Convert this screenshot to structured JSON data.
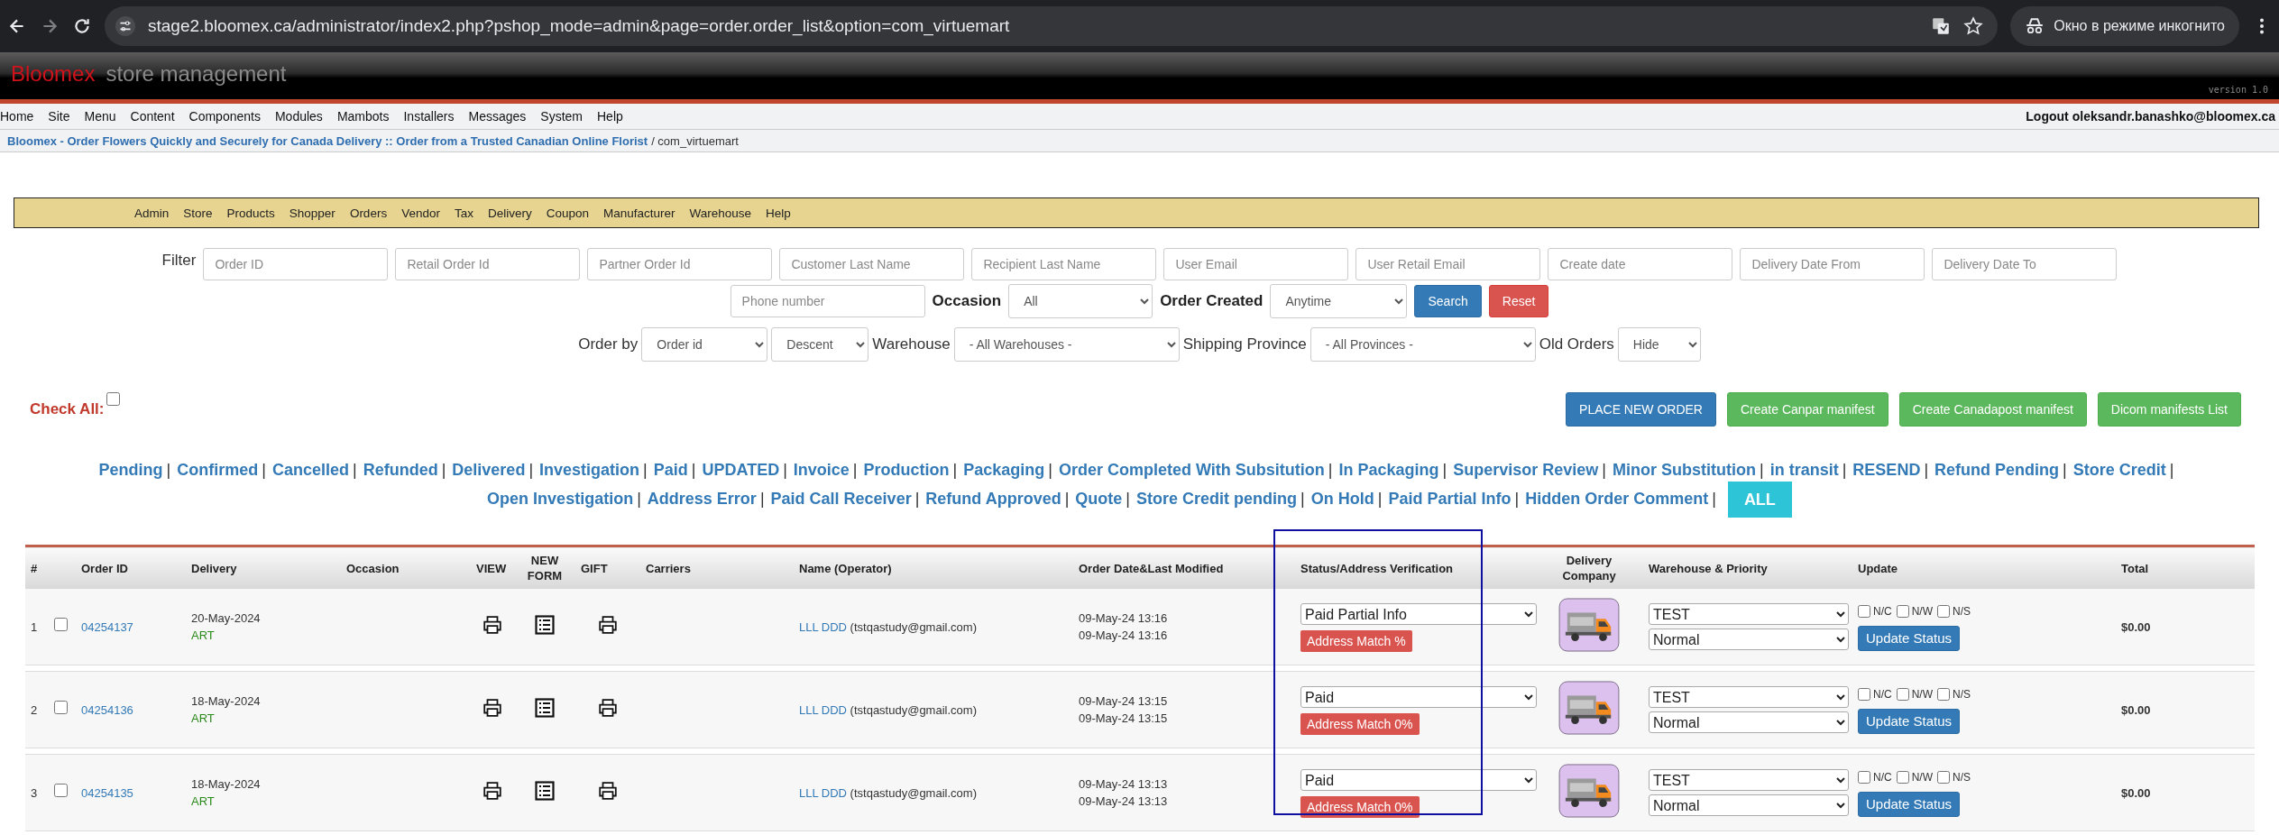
{
  "browser": {
    "url": "stage2.bloomex.ca/administrator/index2.php?pshop_mode=admin&page=order.order_list&option=com_virtuemart",
    "incognito_label": "Окно в режиме инкогнито"
  },
  "header": {
    "brand": "Bloomex",
    "subtitle": "store management",
    "version": "version 1.0"
  },
  "menu": [
    "Home",
    "Site",
    "Menu",
    "Content",
    "Components",
    "Modules",
    "Mambots",
    "Installers",
    "Messages",
    "System",
    "Help"
  ],
  "user": {
    "logout": "Logout",
    "email": "oleksandr.banashko@bloomex.ca"
  },
  "breadcrumb": {
    "site": "Bloomex - Order Flowers Quickly and Securely for Canada Delivery :: Order from a Trusted Canadian Online Florist",
    "current": "/ com_virtuemart"
  },
  "admin_menu": [
    "Admin",
    "Store",
    "Products",
    "Shopper",
    "Orders",
    "Vendor",
    "Tax",
    "Delivery",
    "Coupon",
    "Manufacturer",
    "Warehouse",
    "Help"
  ],
  "filters": {
    "label": "Filter",
    "fields": [
      {
        "placeholder": "Order ID"
      },
      {
        "placeholder": "Retail Order Id"
      },
      {
        "placeholder": "Partner Order Id"
      },
      {
        "placeholder": "Customer Last Name"
      },
      {
        "placeholder": "Recipient Last Name"
      },
      {
        "placeholder": "User Email"
      },
      {
        "placeholder": "User Retail Email"
      },
      {
        "placeholder": "Create date"
      },
      {
        "placeholder": "Delivery Date From"
      },
      {
        "placeholder": "Delivery Date To"
      }
    ],
    "phone": {
      "placeholder": "Phone number"
    },
    "occasion_label": "Occasion",
    "occasion": "All",
    "created_label": "Order Created",
    "created": "Anytime",
    "search": "Search",
    "reset": "Reset"
  },
  "sorting": [
    {
      "label": "Order by",
      "value": "Order id",
      "kind": "select"
    },
    {
      "value": "Descent",
      "kind": "select"
    },
    {
      "label": "Warehouse",
      "value": "- All Warehouses -",
      "kind": "wide"
    },
    {
      "label": "Shipping Province",
      "value": "- All Provinces -",
      "kind": "wide"
    },
    {
      "label": "Old Orders",
      "value": "Hide",
      "kind": "small"
    }
  ],
  "check_all": {
    "label": "Check All:",
    "checked": false
  },
  "actions": [
    {
      "label": "PLACE NEW ORDER",
      "kind": "primary"
    },
    {
      "label": "Create Canpar manifest",
      "kind": "success"
    },
    {
      "label": "Create Canadapost manifest",
      "kind": "success"
    },
    {
      "label": "Dicom manifests List",
      "kind": "success"
    }
  ],
  "status_separator": "|",
  "status_links": [
    {
      "label": "Pending",
      "selected": false
    },
    {
      "label": "Confirmed",
      "selected": false
    },
    {
      "label": "Cancelled",
      "selected": false
    },
    {
      "label": "Refunded",
      "selected": false
    },
    {
      "label": "Delivered",
      "selected": false
    },
    {
      "label": "Investigation",
      "selected": false
    },
    {
      "label": "Paid",
      "selected": false
    },
    {
      "label": "UPDATED",
      "selected": false
    },
    {
      "label": "Invoice",
      "selected": false
    },
    {
      "label": "Production",
      "selected": false
    },
    {
      "label": "Packaging",
      "selected": false
    },
    {
      "label": "Order Completed With Subsitution",
      "selected": false
    },
    {
      "label": "In Packaging",
      "selected": false
    },
    {
      "label": "Supervisor Review",
      "selected": false
    },
    {
      "label": "Minor Substitution",
      "selected": false
    },
    {
      "label": "in transit",
      "selected": false
    },
    {
      "label": "RESEND",
      "selected": false
    },
    {
      "label": "Refund Pending",
      "selected": false
    },
    {
      "label": "Store Credit",
      "selected": false
    },
    {
      "label": "Open Investigation",
      "selected": false
    },
    {
      "label": "Address Error",
      "selected": false
    },
    {
      "label": "Paid Call Receiver",
      "selected": false
    },
    {
      "label": "Refund Approved",
      "selected": false
    },
    {
      "label": "Quote",
      "selected": false
    },
    {
      "label": "Store Credit pending",
      "selected": false
    },
    {
      "label": "On Hold",
      "selected": false
    },
    {
      "label": "Paid Partial Info",
      "selected": false
    },
    {
      "label": "Hidden Order Comment",
      "selected": false
    },
    {
      "label": "ALL",
      "selected": true
    }
  ],
  "table": {
    "columns": [
      "#",
      "Order ID",
      "Delivery",
      "Occasion",
      "VIEW",
      "NEW FORM",
      "GIFT",
      "Carriers",
      "Name (Operator)",
      "Order Date&Last Modified",
      "Status/Address Verification",
      "Delivery Company",
      "Warehouse & Priority",
      "Update",
      "Total"
    ],
    "rows": [
      {
        "number": "1",
        "checked": false,
        "order_id": "04254137",
        "delivery_date": "20-May-2024",
        "delivery_method": "ART",
        "operator": "LLL DDD",
        "email": "(tstqastudy@gmail.com)",
        "order_date": "09-May-24 13:16",
        "modified": "09-May-24 13:16",
        "status": "Paid Partial Info",
        "address_match": "Address Match %",
        "warehouse": "TEST",
        "priority": "Normal",
        "flags": [
          {
            "label": "N/C",
            "checked": false
          },
          {
            "label": "N/W",
            "checked": false
          },
          {
            "label": "N/S",
            "checked": false
          }
        ],
        "update": "Update Status",
        "total": "$0.00"
      },
      {
        "number": "2",
        "checked": false,
        "order_id": "04254136",
        "delivery_date": "18-May-2024",
        "delivery_method": "ART",
        "operator": "LLL DDD",
        "email": "(tstqastudy@gmail.com)",
        "order_date": "09-May-24 13:15",
        "modified": "09-May-24 13:15",
        "status": "Paid",
        "address_match": "Address Match 0%",
        "warehouse": "TEST",
        "priority": "Normal",
        "flags": [
          {
            "label": "N/C",
            "checked": false
          },
          {
            "label": "N/W",
            "checked": false
          },
          {
            "label": "N/S",
            "checked": false
          }
        ],
        "update": "Update Status",
        "total": "$0.00"
      },
      {
        "number": "3",
        "checked": false,
        "order_id": "04254135",
        "delivery_date": "18-May-2024",
        "delivery_method": "ART",
        "operator": "LLL DDD",
        "email": "(tstqastudy@gmail.com)",
        "order_date": "09-May-24 13:13",
        "modified": "09-May-24 13:13",
        "status": "Paid",
        "address_match": "Address Match 0%",
        "warehouse": "TEST",
        "priority": "Normal",
        "flags": [
          {
            "label": "N/C",
            "checked": false
          },
          {
            "label": "N/W",
            "checked": false
          },
          {
            "label": "N/S",
            "checked": false
          }
        ],
        "update": "Update Status",
        "total": "$0.00"
      }
    ]
  }
}
